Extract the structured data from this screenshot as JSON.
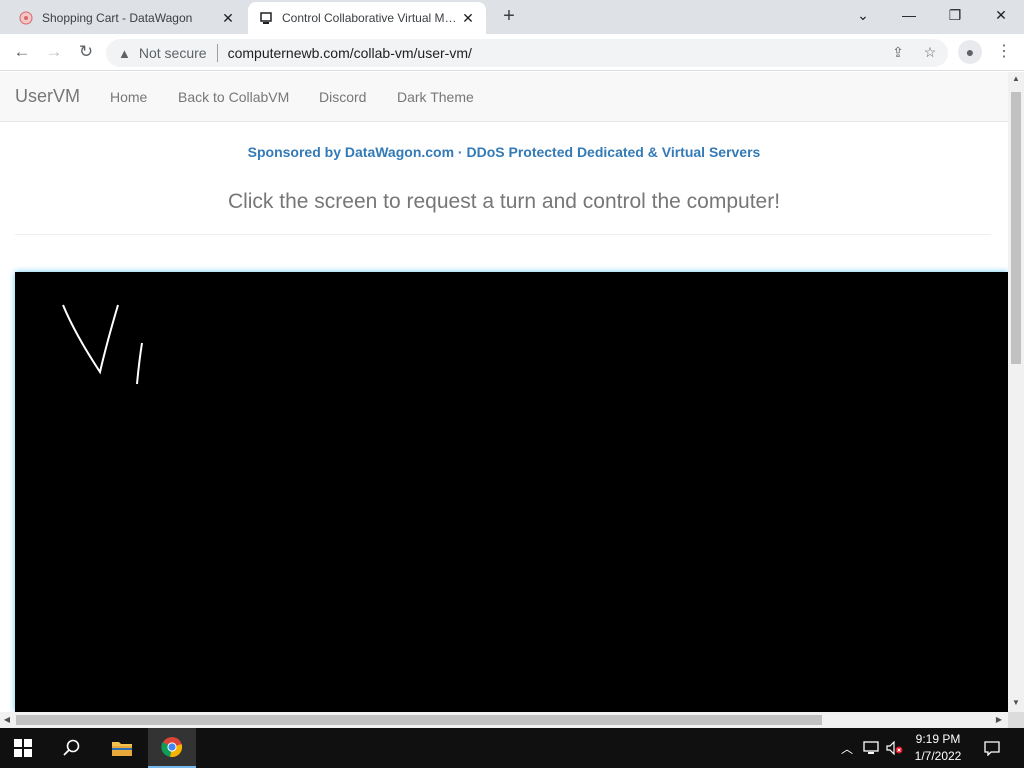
{
  "browser": {
    "tabs": [
      {
        "title": "Shopping Cart - DataWagon",
        "icon": "datawagon-favicon",
        "active": false
      },
      {
        "title": "Control Collaborative Virtual Machines",
        "icon": "collabvm-favicon",
        "active": true
      }
    ],
    "new_tab_label": "+",
    "address": {
      "security_label": "Not secure",
      "url": "computernewb.com/collab-vm/user-vm/"
    }
  },
  "site": {
    "brand": "UserVM",
    "nav": [
      {
        "label": "Home"
      },
      {
        "label": "Back to CollabVM"
      },
      {
        "label": "Discord"
      },
      {
        "label": "Dark Theme"
      }
    ],
    "sponsor_text": "Sponsored by DataWagon.com · DDoS Protected Dedicated & Virtual Servers",
    "lead_text": "Click the screen to request a turn and control the computer!"
  },
  "taskbar": {
    "time": "9:19 PM",
    "date": "1/7/2022",
    "pinned": [
      "start-icon",
      "search-icon",
      "file-explorer-icon",
      "chrome-icon"
    ],
    "tray": [
      "chevron-up-icon",
      "network-icon",
      "volume-muted-icon",
      "notification-icon"
    ]
  },
  "colors": {
    "link": "#337ab7",
    "vm_glow": "#66c8f0",
    "taskbar": "#101010"
  }
}
